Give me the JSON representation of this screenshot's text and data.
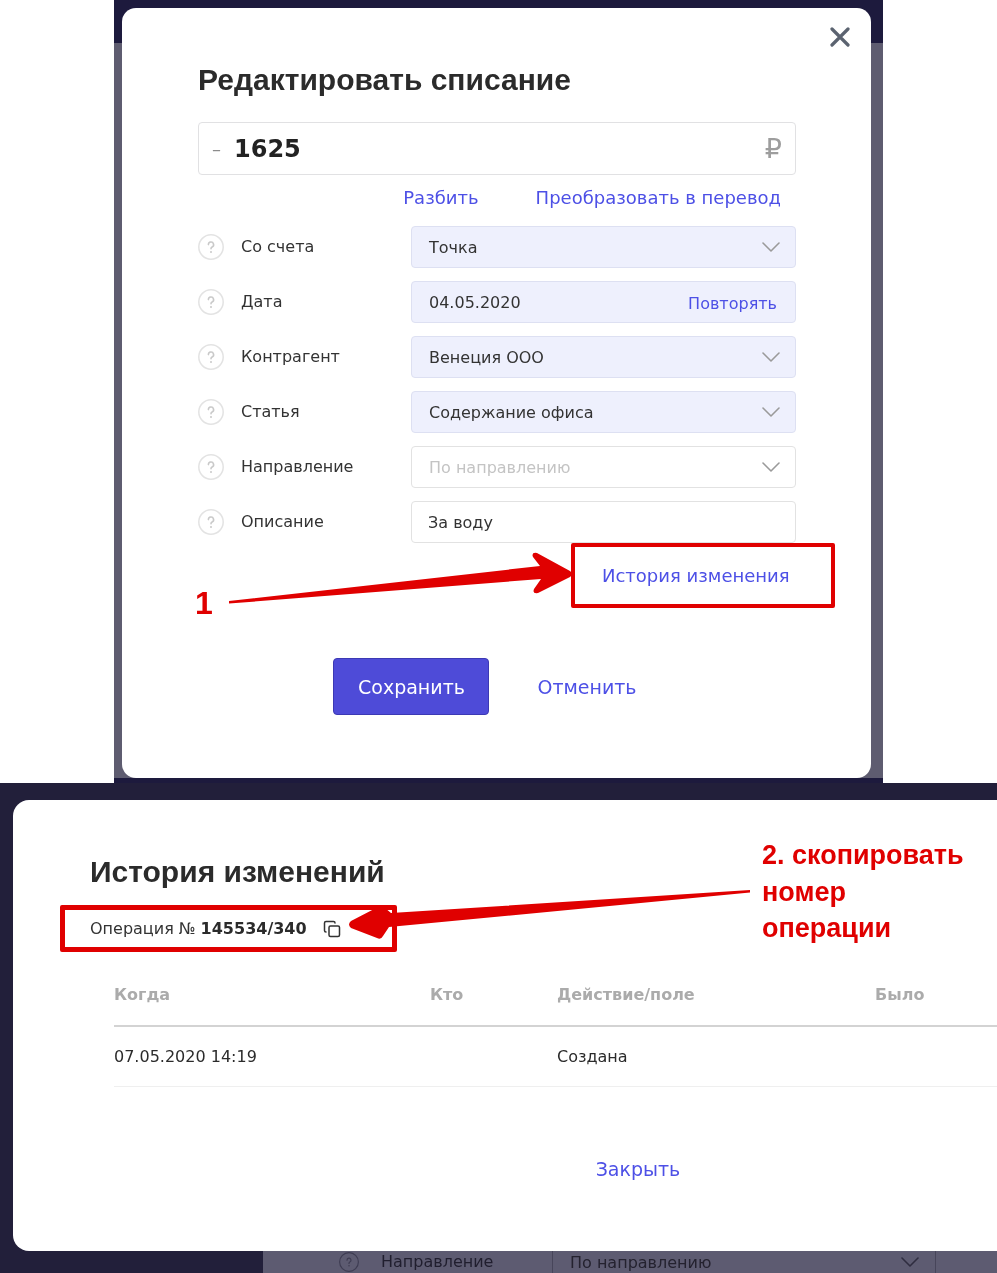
{
  "edit_dialog": {
    "title": "Редактировать списание",
    "amount": {
      "sign": "–",
      "value": "1625",
      "currency": "₽"
    },
    "actions": [
      "Разбить",
      "Преобразовать в перевод"
    ],
    "fields": [
      {
        "label": "Со счета",
        "kind": "select",
        "value": "Точка"
      },
      {
        "label": "Дата",
        "kind": "date",
        "value": "04.05.2020",
        "link": "Повторять"
      },
      {
        "label": "Контрагент",
        "kind": "select",
        "value": "Венеция ООО"
      },
      {
        "label": "Статья",
        "kind": "select",
        "value": "Содержание офиса"
      },
      {
        "label": "Направление",
        "kind": "select",
        "placeholder": "По направлению"
      },
      {
        "label": "Описание",
        "kind": "input",
        "value": "За воду"
      }
    ],
    "history_link": "История изменения",
    "buttons": {
      "save": "Сохранить",
      "cancel": "Отменить"
    }
  },
  "history_dialog": {
    "title": "История изменений",
    "operation": "Операция № **145534/340**",
    "table": {
      "columns": [
        "Когда",
        "Кто",
        "Действие/поле",
        "Было"
      ],
      "rows": [
        {
          "when": "07.05.2020 14:19",
          "action": "Создана"
        }
      ]
    },
    "close": "Закрыть"
  },
  "background_form_row": {
    "label": "Направление",
    "placeholder": "По направлению"
  },
  "annotations": [
    {
      "text": "1"
    },
    {
      "text": "2. скопировать номер операции"
    }
  ]
}
